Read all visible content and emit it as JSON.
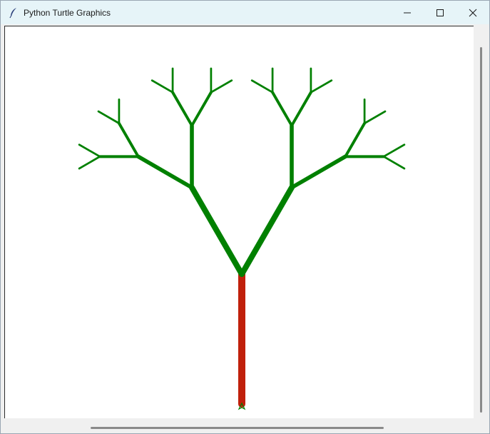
{
  "window": {
    "title": "Python Turtle Graphics",
    "icon": "feather-icon",
    "controls": [
      "minimize-icon",
      "maximize-icon",
      "close-icon"
    ]
  },
  "canvas": {
    "background": "#ffffff",
    "trunk_color": "#c0200b",
    "branch_color": "#008000",
    "turtle_color": "#008000"
  }
}
